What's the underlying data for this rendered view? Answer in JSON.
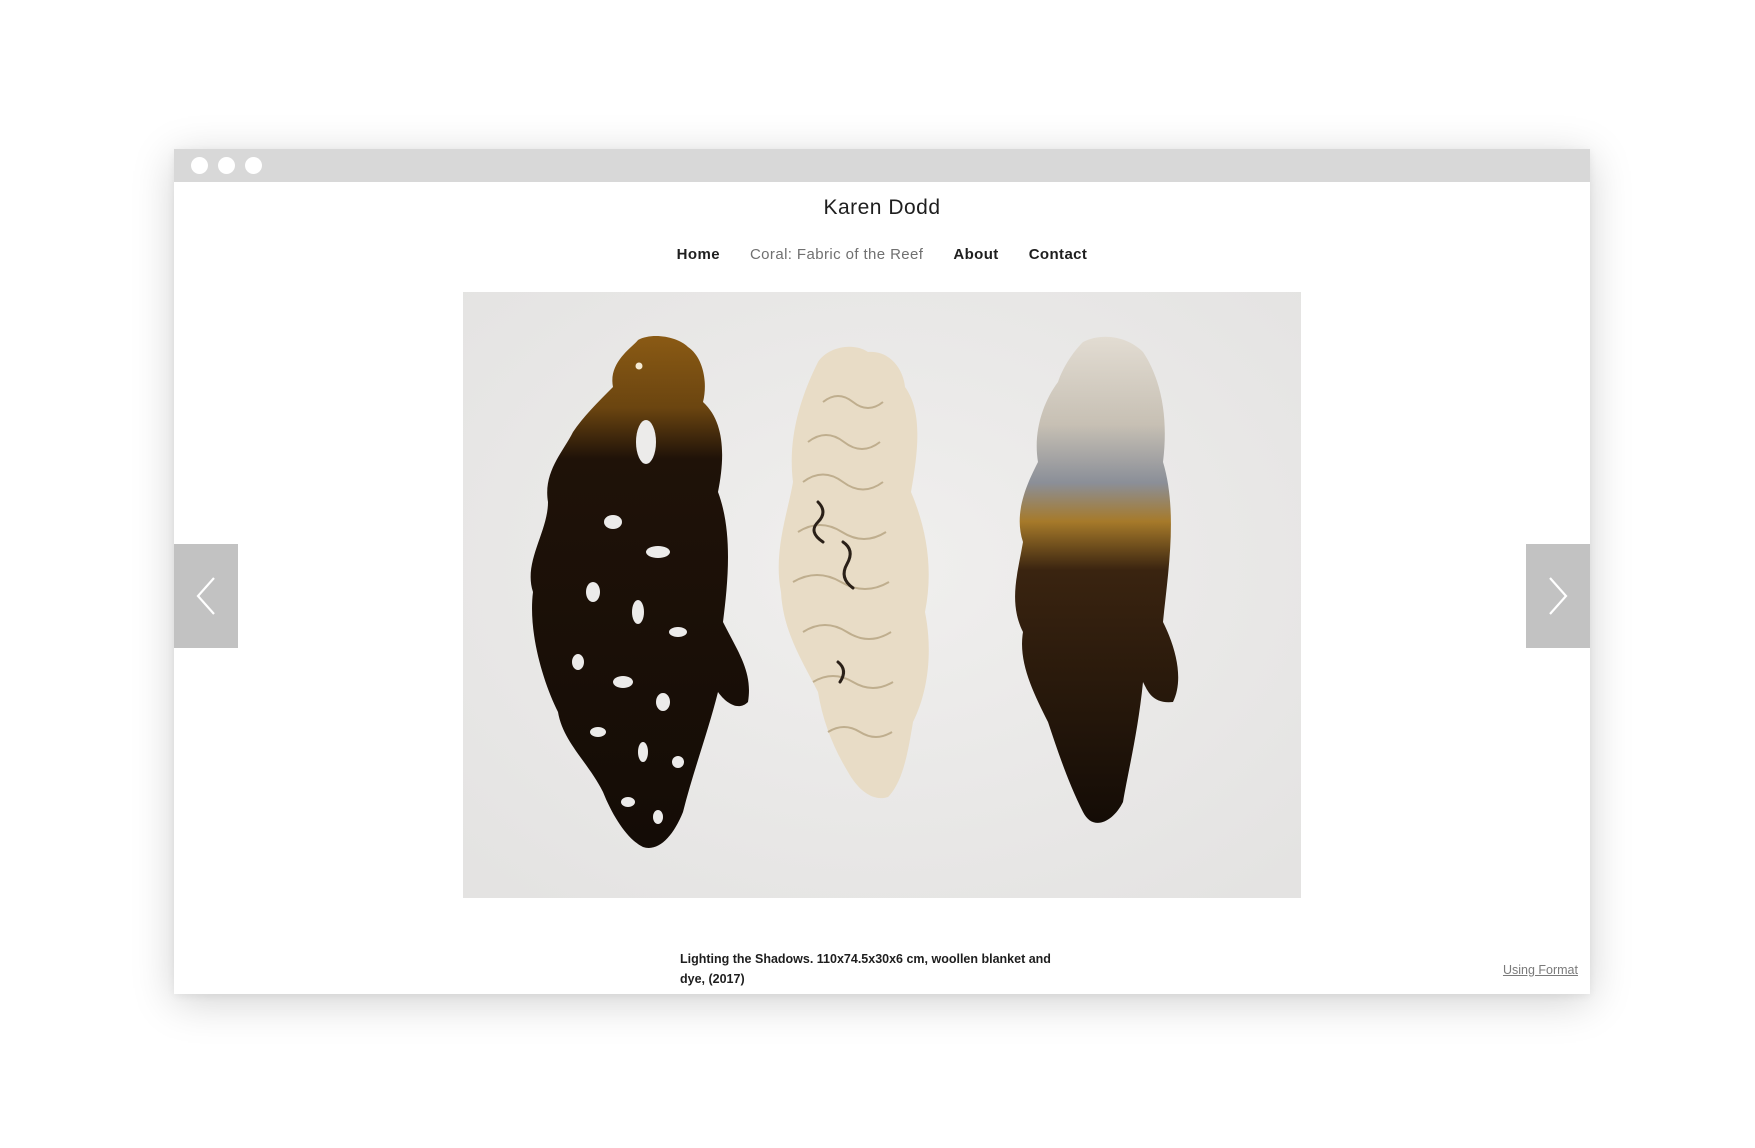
{
  "site": {
    "title": "Karen Dodd"
  },
  "nav": {
    "items": [
      {
        "label": "Home"
      },
      {
        "label": "Coral: Fabric of the Reef"
      },
      {
        "label": "About"
      },
      {
        "label": "Contact"
      }
    ],
    "active_item": "Coral: Fabric of the Reef"
  },
  "slideshow": {
    "caption": "Lighting the Shadows. 110x74.5x30x6 cm, woollen blanket and dye, (2017)",
    "prev_icon": "chevron-left-icon",
    "next_icon": "chevron-right-icon"
  },
  "footer": {
    "credit": "Using Format"
  },
  "colors": {
    "titlebar": "#d8d8d8",
    "arrow_bg": "#c2c2c2",
    "slide_bg": "#ecebea",
    "active_nav": "#707070",
    "text": "#1e1e1e"
  }
}
